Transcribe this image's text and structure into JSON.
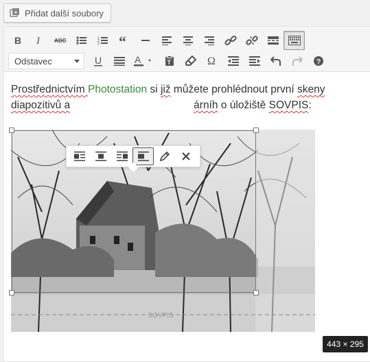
{
  "media": {
    "add_label": "Přidat další soubory"
  },
  "toolbar": {
    "row1": [
      "bold",
      "italic",
      "strikethrough",
      "bullet-list",
      "numbered-list",
      "blockquote",
      "horizontal-line",
      "align-left",
      "align-center",
      "align-right",
      "insert-link",
      "remove-link",
      "read-more",
      "toolbar-toggle"
    ],
    "format_select": "Odstavec",
    "row2": [
      "underline",
      "justify",
      "text-color",
      "paste-as-text",
      "clear-formatting",
      "special-character",
      "outdent",
      "indent",
      "undo",
      "redo",
      "help"
    ]
  },
  "content": {
    "line1_before": "Prostřednictvím ",
    "line1_link": "Photostation",
    "line1_after_1": " si ",
    "line1_word_jiz": "již",
    "line1_after_2": " můžete prohlédnout první ",
    "line1_word_skeny": "skeny",
    "line2_start": "diapozitivů a",
    "line2_mid": "árníh",
    "line2_end": " o úložiště ",
    "line2_sovpis": "SOVPIS",
    "line2_colon": ":"
  },
  "image": {
    "alt": "Black-and-white photo of an old ruined house among bare trees",
    "watermark": "SOVPIS"
  },
  "image_toolbar": [
    "align-left",
    "align-center",
    "align-right",
    "align-none",
    "edit",
    "remove"
  ],
  "dimensions": "443 × 295"
}
